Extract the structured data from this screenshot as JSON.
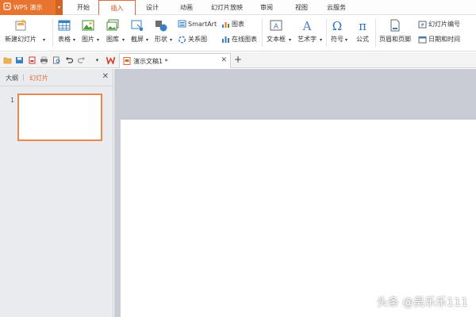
{
  "app": {
    "name": "WPS 演示"
  },
  "menu": {
    "tabs": [
      {
        "label": "开始"
      },
      {
        "label": "插入"
      },
      {
        "label": "设计"
      },
      {
        "label": "动画"
      },
      {
        "label": "幻灯片放映"
      },
      {
        "label": "审阅"
      },
      {
        "label": "视图"
      },
      {
        "label": "云服务"
      }
    ],
    "active": "插入"
  },
  "ribbon": {
    "new_slide": "新建幻灯片",
    "table": "表格",
    "picture": "图片",
    "gallery": "图库",
    "screenshot": "截屏",
    "shape": "形状",
    "smartart": "SmartArt",
    "chart": "图表",
    "relation": "关系图",
    "online_chart": "在线图表",
    "textbox": "文本框",
    "wordart": "艺术字",
    "symbol": "符号",
    "formula": "公式",
    "header_footer": "页眉和页脚",
    "slide_number": "幻灯片编号",
    "date_time": "日期和时间"
  },
  "document": {
    "tab_title": "演示文稿1 *"
  },
  "left_panel": {
    "tab_outline": "大纲",
    "tab_divider": "|",
    "tab_slides": "幻灯片",
    "slide_number": "1"
  },
  "watermark": "头条 @吴乐乐111",
  "colors": {
    "accent": "#e8742f",
    "active_tab": "#c8501f",
    "canvas_bg": "#c9ccd4"
  }
}
